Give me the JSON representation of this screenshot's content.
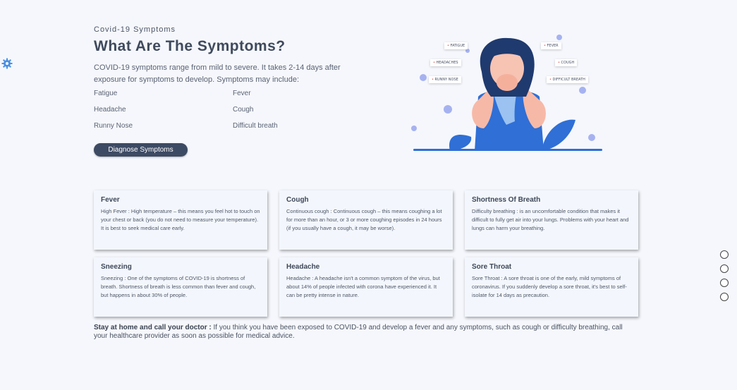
{
  "hero": {
    "eyebrow": "Covid-19 Symptoms",
    "title": "What Are The Symptoms?",
    "intro": "COVID-19 symptoms range from mild to severe. It takes 2-14 days after exposure for symptoms to develop. Symptoms may include:",
    "symptoms": [
      "Fatigue",
      "Fever",
      "Headache",
      "Cough",
      "Runny Nose",
      "Difficult breath"
    ],
    "button_label": "Diagnose Symptoms"
  },
  "illustration": {
    "tags": [
      "FATIGUE",
      "FEVER",
      "HEADACHES",
      "COUGH",
      "RUNNY NOSE",
      "DIFFICULT BREATH"
    ]
  },
  "cards": [
    {
      "title": "Fever",
      "text": "High Fever : High temperature – this means you feel hot to touch on your chest or back (you do not need to measure your temperature). It is best to seek medical care early."
    },
    {
      "title": "Cough",
      "text": "Continuous cough : Continuous cough – this means coughing a lot for more than an hour, or 3 or more coughing episodes in 24 hours (if you usually have a cough, it may be worse)."
    },
    {
      "title": "Shortness Of Breath",
      "text": "Difficulty breathing : is an uncomfortable condition that makes it difficult to fully get air into your lungs. Problems with your heart and lungs can harm your breathing."
    },
    {
      "title": "Sneezing",
      "text": "Sneezing : One of the symptoms of COVID-19 is shortness of breath. Shortness of breath is less common than fever and cough, but happens in about 30% of people."
    },
    {
      "title": "Headache",
      "text": "Headache : A headache isn't a common symptom of the virus, but about 14% of people infected with corona have experienced it. It can be pretty intense in nature."
    },
    {
      "title": "Sore Throat",
      "text": "Sore Throat : A sore throat is one of the early, mild symptoms of coronavirus. If you suddenly develop a sore throat, it's best to self-isolate for 14 days as precaution."
    }
  ],
  "footer": {
    "lead": "Stay at home and call your doctor :",
    "text": " If you think you have been exposed to COVID-19 and develop a fever and any symptoms, such as cough or difficulty breathing, call your healthcare provider as soon as possible for medical advice."
  },
  "colors": {
    "accent": "#3d4a63",
    "illustration_blue": "#2f6fd6",
    "virus": "#9aa7ee"
  },
  "icons": [
    "gear-icon",
    "nav-dot-icon"
  ]
}
